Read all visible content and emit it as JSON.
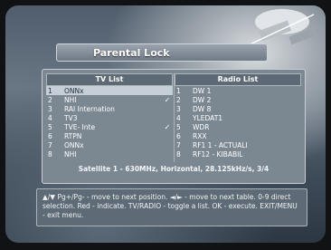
{
  "title": "Parental Lock",
  "tv_list": {
    "header": "TV List",
    "items": [
      {
        "num": "1",
        "name": "ONNx",
        "locked": false,
        "selected": true
      },
      {
        "num": "2",
        "name": "NHI",
        "locked": true,
        "selected": false
      },
      {
        "num": "3",
        "name": "RAI Internation",
        "locked": false,
        "selected": false
      },
      {
        "num": "4",
        "name": "TV3",
        "locked": false,
        "selected": false
      },
      {
        "num": "5",
        "name": "TVE- Inte",
        "locked": true,
        "selected": false
      },
      {
        "num": "6",
        "name": "RTPN",
        "locked": false,
        "selected": false
      },
      {
        "num": "7",
        "name": "ONNx",
        "locked": false,
        "selected": false
      },
      {
        "num": "8",
        "name": "NHI",
        "locked": false,
        "selected": false
      }
    ]
  },
  "radio_list": {
    "header": "Radio List",
    "items": [
      {
        "num": "1",
        "name": "DW 1"
      },
      {
        "num": "2",
        "name": "DW 2"
      },
      {
        "num": "3",
        "name": "DW 8"
      },
      {
        "num": "4",
        "name": "YLEDAT1"
      },
      {
        "num": "5",
        "name": "WDR"
      },
      {
        "num": "6",
        "name": "RXX"
      },
      {
        "num": "7",
        "name": "RF1 1 - ACTUALI"
      },
      {
        "num": "8",
        "name": "RF12 - KIBABIL"
      }
    ]
  },
  "status_line": "Satellite 1 - 630MHz, Horizontal, 28.125kHz/s, 3/4",
  "help_text": "▲/▼ Pg+/Pg- - move to next position. ◄/► - move to next table. 0-9 direct selection. Red - indicate. TV/RADIO - toggle a list. OK - execute. EXIT/MENU - exit menu.",
  "lock_icon_name": "checkmark-icon"
}
